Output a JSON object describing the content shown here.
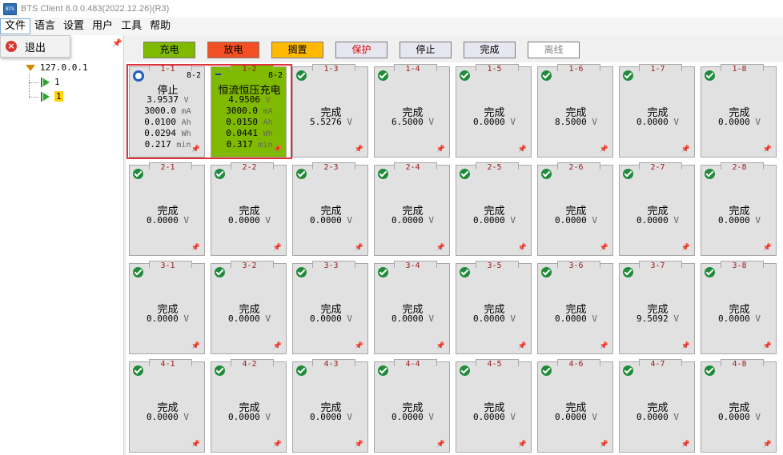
{
  "window": {
    "title": "BTS Client 8.0.0.483(2022.12.26)(R3)",
    "icon": "app-icon"
  },
  "menu": [
    {
      "label": "文件",
      "active": true
    },
    {
      "label": "语言"
    },
    {
      "label": "设置"
    },
    {
      "label": "用户"
    },
    {
      "label": "工具"
    },
    {
      "label": "帮助"
    }
  ],
  "file_menu": {
    "exit_label": "退出"
  },
  "tree": {
    "ip": "127.0.0.1",
    "child1": "1",
    "child2": "1"
  },
  "legend": [
    {
      "label": "充电",
      "bg": "#7fba00",
      "color": "#000000"
    },
    {
      "label": "放电",
      "bg": "#f25022",
      "color": "#000000"
    },
    {
      "label": "搁置",
      "bg": "#ffb900",
      "color": "#000000"
    },
    {
      "label": "保护",
      "bg": "#e6e6f0",
      "color": "#e00000"
    },
    {
      "label": "停止",
      "bg": "#e6e6f0",
      "color": "#000000"
    },
    {
      "label": "完成",
      "bg": "#e6e6f0",
      "color": "#000000"
    },
    {
      "label": "离线",
      "bg": "#ffffff",
      "color": "#888888"
    }
  ],
  "unit": "V",
  "channels": [
    {
      "id": "1-1",
      "status": "停止",
      "code": "8-2",
      "icon": "ring",
      "voltage": "3.9537",
      "current": "3000.0",
      "current_unit": "mA",
      "capacity": "0.0100",
      "capacity_unit": "Ah",
      "energy": "0.0294",
      "energy_unit": "Wh",
      "time": "0.217",
      "time_unit": "min"
    },
    {
      "id": "1-2",
      "status": "恒流恒压充电",
      "code": "8-2",
      "icon": "minus",
      "voltage": "4.9506",
      "current": "3000.0",
      "current_unit": "mA",
      "capacity": "0.0150",
      "capacity_unit": "Ah",
      "energy": "0.0441",
      "energy_unit": "Wh",
      "time": "0.317",
      "time_unit": "min"
    },
    {
      "id": "1-3",
      "status": "完成",
      "voltage": "5.5276"
    },
    {
      "id": "1-4",
      "status": "完成",
      "voltage": "6.5000"
    },
    {
      "id": "1-5",
      "status": "完成",
      "voltage": "0.0000"
    },
    {
      "id": "1-6",
      "status": "完成",
      "voltage": "8.5000"
    },
    {
      "id": "1-7",
      "status": "完成",
      "voltage": "0.0000"
    },
    {
      "id": "1-8",
      "status": "完成",
      "voltage": "0.0000"
    },
    {
      "id": "2-1",
      "status": "完成",
      "voltage": "0.0000"
    },
    {
      "id": "2-2",
      "status": "完成",
      "voltage": "0.0000"
    },
    {
      "id": "2-3",
      "status": "完成",
      "voltage": "0.0000"
    },
    {
      "id": "2-4",
      "status": "完成",
      "voltage": "0.0000"
    },
    {
      "id": "2-5",
      "status": "完成",
      "voltage": "0.0000"
    },
    {
      "id": "2-6",
      "status": "完成",
      "voltage": "0.0000"
    },
    {
      "id": "2-7",
      "status": "完成",
      "voltage": "0.0000"
    },
    {
      "id": "2-8",
      "status": "完成",
      "voltage": "0.0000"
    },
    {
      "id": "3-1",
      "status": "完成",
      "voltage": "0.0000"
    },
    {
      "id": "3-2",
      "status": "完成",
      "voltage": "0.0000"
    },
    {
      "id": "3-3",
      "status": "完成",
      "voltage": "0.0000"
    },
    {
      "id": "3-4",
      "status": "完成",
      "voltage": "0.0000"
    },
    {
      "id": "3-5",
      "status": "完成",
      "voltage": "0.0000"
    },
    {
      "id": "3-6",
      "status": "完成",
      "voltage": "0.0000"
    },
    {
      "id": "3-7",
      "status": "完成",
      "voltage": "9.5092"
    },
    {
      "id": "3-8",
      "status": "完成",
      "voltage": "0.0000"
    },
    {
      "id": "4-1",
      "status": "完成",
      "voltage": "0.0000"
    },
    {
      "id": "4-2",
      "status": "完成",
      "voltage": "0.0000"
    },
    {
      "id": "4-3",
      "status": "完成",
      "voltage": "0.0000"
    },
    {
      "id": "4-4",
      "status": "完成",
      "voltage": "0.0000"
    },
    {
      "id": "4-5",
      "status": "完成",
      "voltage": "0.0000"
    },
    {
      "id": "4-6",
      "status": "完成",
      "voltage": "0.0000"
    },
    {
      "id": "4-7",
      "status": "完成",
      "voltage": "0.0000"
    },
    {
      "id": "4-8",
      "status": "完成",
      "voltage": "0.0000"
    }
  ]
}
